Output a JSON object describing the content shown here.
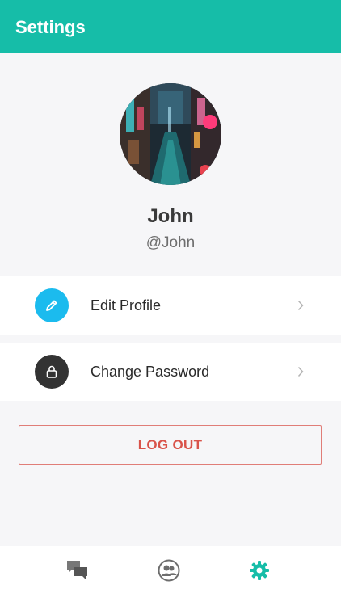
{
  "header": {
    "title": "Settings"
  },
  "profile": {
    "name": "John",
    "handle": "@John",
    "avatar_description": "avatar-photo"
  },
  "menu": [
    {
      "label": "Edit Profile",
      "icon": "pencil-icon",
      "icon_bg": "#1bbbee"
    },
    {
      "label": "Change Password",
      "icon": "lock-icon",
      "icon_bg": "#333333"
    }
  ],
  "logout": {
    "label": "LOG OUT",
    "color": "#d9534a"
  },
  "bottom_nav": [
    {
      "name": "chats",
      "icon": "chat-bubbles-icon",
      "active": false
    },
    {
      "name": "contacts",
      "icon": "people-icon",
      "active": false
    },
    {
      "name": "settings",
      "icon": "gear-icon",
      "active": true
    }
  ],
  "colors": {
    "brand": "#16bda8",
    "background": "#f6f6f8"
  }
}
